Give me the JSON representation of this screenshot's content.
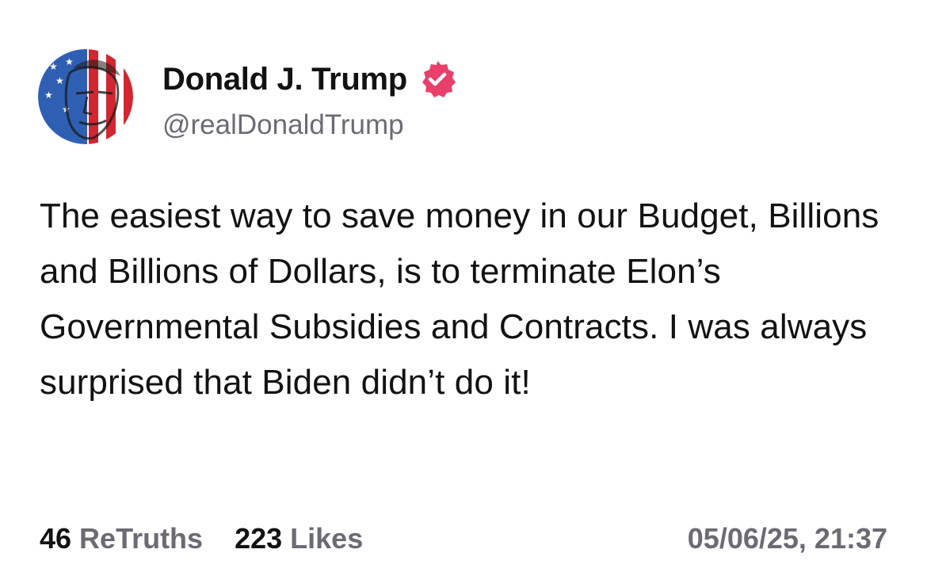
{
  "author": {
    "display_name": "Donald J. Trump",
    "handle": "@realDonaldTrump",
    "verified": true,
    "verified_badge_color": "#e8406a",
    "avatar_icon": "avatar-flag-portrait"
  },
  "post": {
    "text": "The easiest way to save money in our Budget, Billions and Billions of Dollars, is to terminate Elon’s Governmental Subsidies and Contracts. I was always surprised that Biden didn’t do it!"
  },
  "stats": {
    "retruths_count": "46",
    "retruths_label": "ReTruths",
    "likes_count": "223",
    "likes_label": "Likes"
  },
  "timestamp": "05/06/25, 21:37",
  "colors": {
    "text_primary": "#121212",
    "text_secondary": "#6b6b73",
    "background": "#ffffff"
  }
}
